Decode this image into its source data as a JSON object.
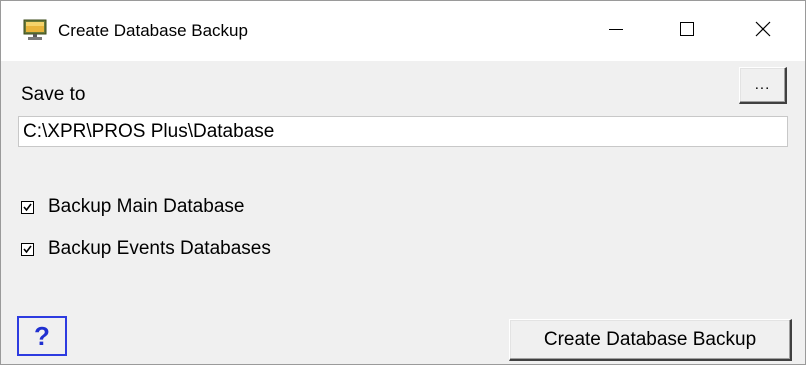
{
  "window": {
    "title": "Create Database Backup",
    "icon": "monitor-icon"
  },
  "caption_buttons": {
    "minimize": "minimize-icon",
    "maximize": "maximize-icon",
    "close": "close-icon"
  },
  "save_to": {
    "label": "Save to",
    "browse_label": "...",
    "path_value": "C:\\XPR\\PROS Plus\\Database"
  },
  "options": [
    {
      "label": "Backup Main Database",
      "checked": true
    },
    {
      "label": "Backup Events Databases",
      "checked": true
    }
  ],
  "footer": {
    "help_label": "?",
    "create_label": "Create Database Backup"
  },
  "colors": {
    "window_bg": "#f0f0f0",
    "titlebar_bg": "#ffffff",
    "help_accent": "#2d3be0"
  }
}
